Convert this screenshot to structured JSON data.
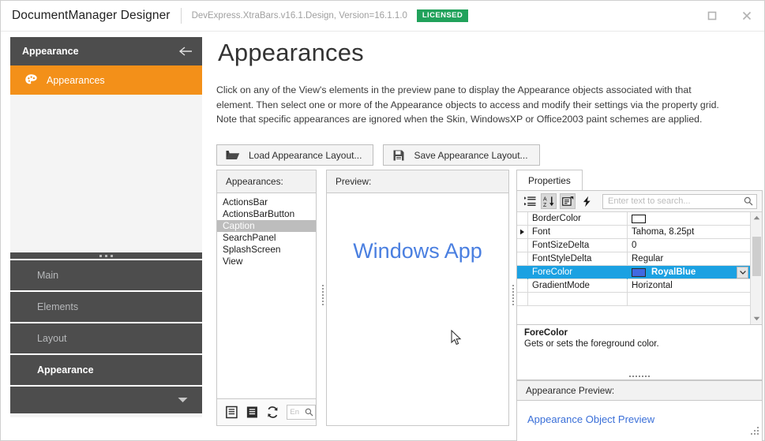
{
  "titlebar": {
    "app_title": "DocumentManager Designer",
    "assembly": "DevExpress.XtraBars.v16.1.Design, Version=16.1.1.0",
    "license_badge": "LICENSED",
    "maximize_tooltip": "Maximize",
    "close_tooltip": "Close"
  },
  "sidebar": {
    "header_title": "Appearance",
    "active_item": "Appearances",
    "nav_items": [
      {
        "label": "Main",
        "active": false
      },
      {
        "label": "Elements",
        "active": false
      },
      {
        "label": "Layout",
        "active": false
      },
      {
        "label": "Appearance",
        "active": true
      }
    ]
  },
  "content": {
    "page_title": "Appearances",
    "description": "Click on any of the View's elements in the preview pane to display the Appearance objects associated with that element. Then select one or more of the Appearance objects to access and modify their settings via the property grid. Note that specific appearances are ignored when the Skin, WindowsXP or Office2003 paint schemes are applied.",
    "load_button": "Load Appearance Layout...",
    "save_button": "Save Appearance Layout..."
  },
  "appearances_pane": {
    "header": "Appearances:",
    "items": [
      {
        "label": "ActionsBar",
        "selected": false
      },
      {
        "label": "ActionsBarButton",
        "selected": false
      },
      {
        "label": "Caption",
        "selected": true
      },
      {
        "label": "SearchPanel",
        "selected": false
      },
      {
        "label": "SplashScreen",
        "selected": false
      },
      {
        "label": "View",
        "selected": false
      }
    ],
    "search_placeholder": "En"
  },
  "preview_pane": {
    "header": "Preview:",
    "app_text": "Windows App",
    "app_text_color": "#4a7fe0"
  },
  "properties_pane": {
    "tab_label": "Properties",
    "search_placeholder": "Enter text to search...",
    "rows": [
      {
        "name": "BorderColor",
        "value": "",
        "swatch": "white",
        "expandable": false,
        "selected": false
      },
      {
        "name": "Font",
        "value": "Tahoma, 8.25pt",
        "swatch": "",
        "expandable": true,
        "selected": false
      },
      {
        "name": "FontSizeDelta",
        "value": "0",
        "swatch": "",
        "expandable": false,
        "selected": false
      },
      {
        "name": "FontStyleDelta",
        "value": "Regular",
        "swatch": "",
        "expandable": false,
        "selected": false
      },
      {
        "name": "ForeColor",
        "value": "RoyalBlue",
        "swatch": "royal",
        "expandable": false,
        "selected": true
      },
      {
        "name": "GradientMode",
        "value": "Horizontal",
        "swatch": "",
        "expandable": false,
        "selected": false
      }
    ],
    "selected_row_color": "#1ba1e2",
    "royalblue_hex": "#4169e1",
    "description": {
      "title": "ForeColor",
      "text": "Gets or sets the foreground color."
    },
    "appearance_preview": {
      "header": "Appearance Preview:",
      "link": "Appearance Object Preview"
    }
  }
}
